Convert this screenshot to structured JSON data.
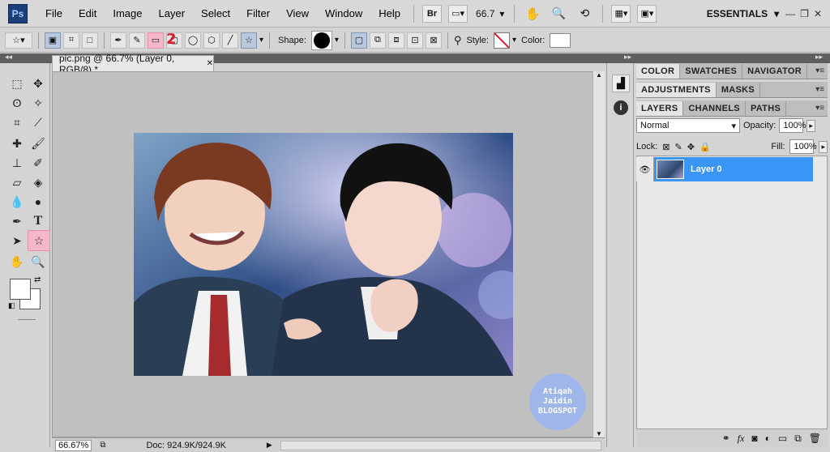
{
  "app": {
    "logo": "Ps",
    "menus": [
      "File",
      "Edit",
      "Image",
      "Layer",
      "Select",
      "Filter",
      "View",
      "Window",
      "Help"
    ],
    "bridge": "Br",
    "zoom": "66.7",
    "workspace": "ESSENTIALS"
  },
  "options": {
    "shape_label": "Shape:",
    "style_label": "Style:",
    "color_label": "Color:",
    "shape_color": "#000000",
    "color_value": "#ffffff"
  },
  "document": {
    "tab_title": "pic.png @ 66.7% (Layer 0, RGB/8) *",
    "zoom": "66.67%",
    "doc_size": "Doc: 924.9K/924.9K"
  },
  "annotations": {
    "tool_marker": "1",
    "option_marker": "2"
  },
  "watermark": {
    "line1": "Atiqah",
    "line2": "Jaidin",
    "line3": "BLOGSPOT"
  },
  "panels": {
    "group1": [
      "COLOR",
      "SWATCHES",
      "NAVIGATOR"
    ],
    "group2": [
      "ADJUSTMENTS",
      "MASKS"
    ],
    "group3": [
      "LAYERS",
      "CHANNELS",
      "PATHS"
    ],
    "blend_mode": "Normal",
    "opacity_label": "Opacity:",
    "opacity": "100%",
    "lock_label": "Lock:",
    "fill_label": "Fill:",
    "fill": "100%",
    "layer_name": "Layer 0"
  },
  "colors": {
    "selection": "#3a95f4",
    "annotation": "#e0182d",
    "highlight": "#f5b8c8"
  }
}
